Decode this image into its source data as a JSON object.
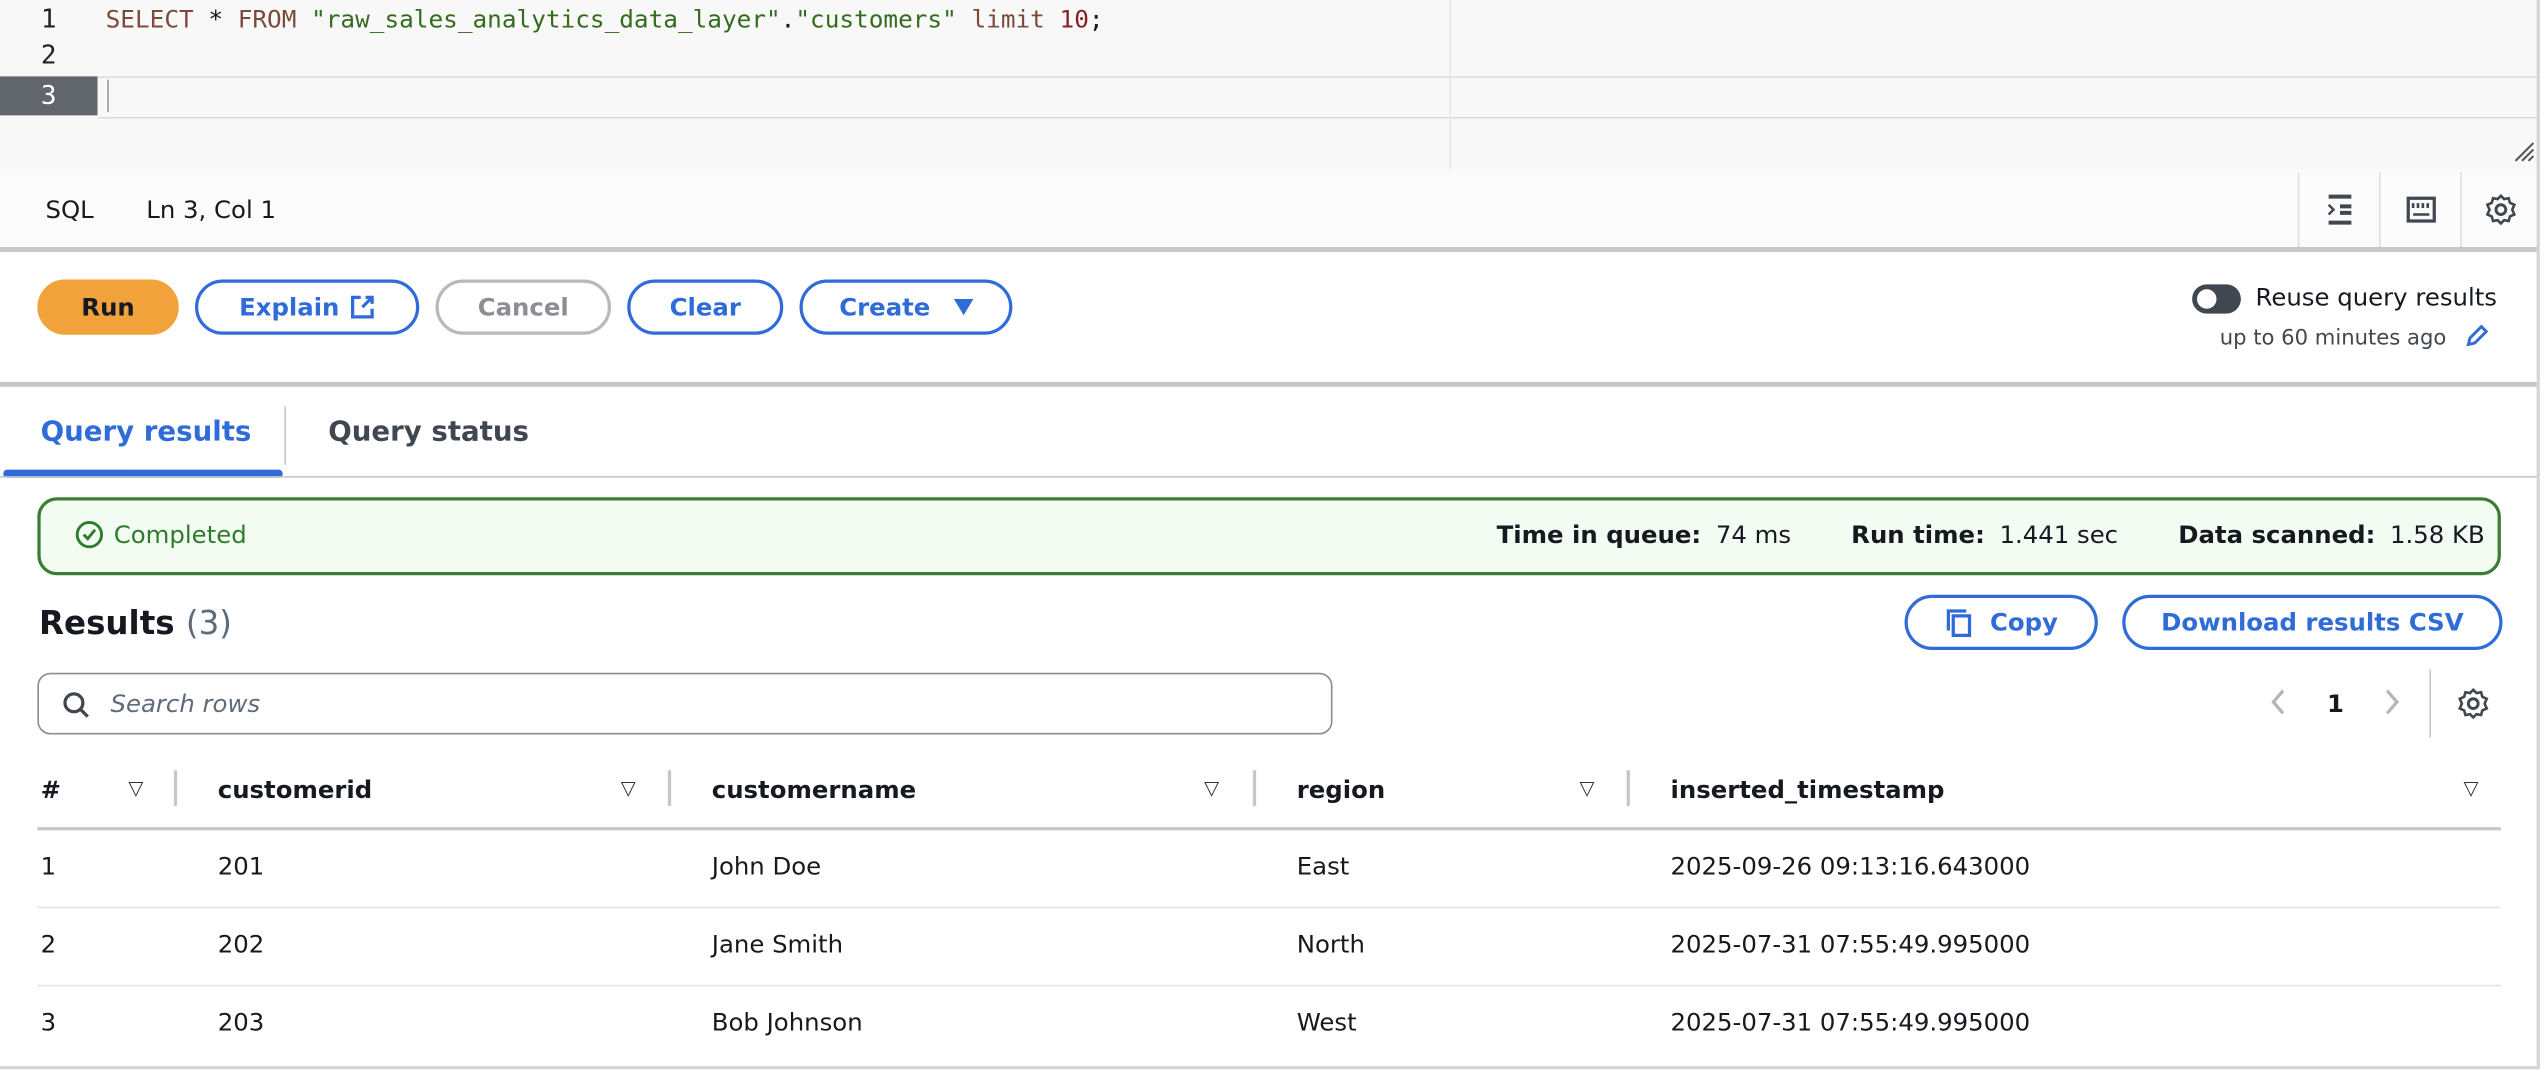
{
  "editor": {
    "line_numbers": [
      "1",
      "2",
      "3"
    ],
    "code": {
      "select": "SELECT",
      "star": " * ",
      "from": "FROM",
      "db": "\"raw_sales_analytics_data_layer\"",
      "dot": ".",
      "table": "\"customers\"",
      "limit": "limit",
      "limit_value": "10",
      "semicolon": ";"
    }
  },
  "statusbar": {
    "language": "SQL",
    "cursor_position": "Ln 3, Col 1"
  },
  "toolbar": {
    "run": "Run",
    "explain": "Explain",
    "cancel": "Cancel",
    "clear": "Clear",
    "create": "Create",
    "reuse_label": "Reuse query results",
    "reuse_sub": "up to 60 minutes ago"
  },
  "tabs": [
    {
      "label": "Query results"
    },
    {
      "label": "Query status"
    }
  ],
  "status": {
    "state": "Completed",
    "time_in_queue_label": "Time in queue:",
    "time_in_queue": "74 ms",
    "run_time_label": "Run time:",
    "run_time": "1.441 sec",
    "data_scanned_label": "Data scanned:",
    "data_scanned": "1.58 KB"
  },
  "results": {
    "title": "Results",
    "count": "(3)",
    "copy": "Copy",
    "download": "Download results CSV",
    "search_placeholder": "Search rows",
    "page": "1",
    "columns": [
      "#",
      "customerid",
      "customername",
      "region",
      "inserted_timestamp"
    ],
    "rows": [
      [
        "1",
        "201",
        "John Doe",
        "East",
        "2025-09-26 09:13:16.643000"
      ],
      [
        "2",
        "202",
        "Jane Smith",
        "North",
        "2025-07-31 07:55:49.995000"
      ],
      [
        "3",
        "203",
        "Bob Johnson",
        "West",
        "2025-07-31 07:55:49.995000"
      ]
    ]
  },
  "colors": {
    "accent": "#2f6bd9",
    "run": "#f2a23a",
    "success": "#3a7d34"
  }
}
